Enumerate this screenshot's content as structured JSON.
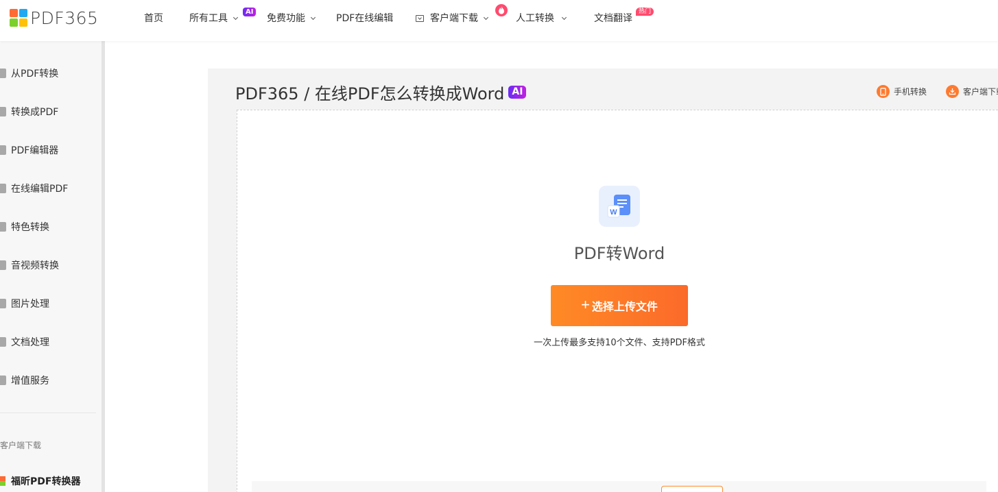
{
  "brand": {
    "logo_text": "PDF365",
    "colors": {
      "accent": "#ff7a2e",
      "ai_badge": "#8a26ea",
      "hot_badge": "#ff4b6e",
      "logo": [
        "#ff6b35",
        "#21a8f2",
        "#7bd02b",
        "#ffc107"
      ]
    }
  },
  "nav": {
    "home": "首页",
    "all_tools": "所有工具",
    "all_tools_badge": "AI",
    "free_features": "免费功能",
    "pdf_online_edit": "PDF在线编辑",
    "client_download": "客户端下载",
    "human_convert": "人工转换",
    "doc_translate": "文档翻译",
    "doc_translate_badge": "热门"
  },
  "sidebar": {
    "items": [
      {
        "label": "从PDF转换"
      },
      {
        "label": "转换成PDF"
      },
      {
        "label": "PDF编辑器"
      },
      {
        "label": "在线编辑PDF"
      },
      {
        "label": "特色转换"
      },
      {
        "label": "音视频转换"
      },
      {
        "label": "图片处理"
      },
      {
        "label": "文档处理"
      },
      {
        "label": "增值服务"
      }
    ],
    "section_label": "客户端下载",
    "app_label": "福昕PDF转换器"
  },
  "main": {
    "title": "PDF365 / 在线PDF怎么转换成Word",
    "title_badge": "AI",
    "mobile_convert": "手机转换",
    "client_download": "客户端下载",
    "file_icon_letter": "W",
    "tool_name": "PDF转Word",
    "upload_plus": "+",
    "upload_button": "选择上传文件",
    "upload_hint": "一次上传最多支持10个文件、支持PDF格式"
  },
  "icons": {
    "logo": "four-square-logo-icon",
    "download": "download-icon",
    "fire": "fire-icon",
    "chevron": "chevron-down-icon",
    "mobile": "mobile-phone-icon",
    "file_word": "word-document-icon"
  }
}
